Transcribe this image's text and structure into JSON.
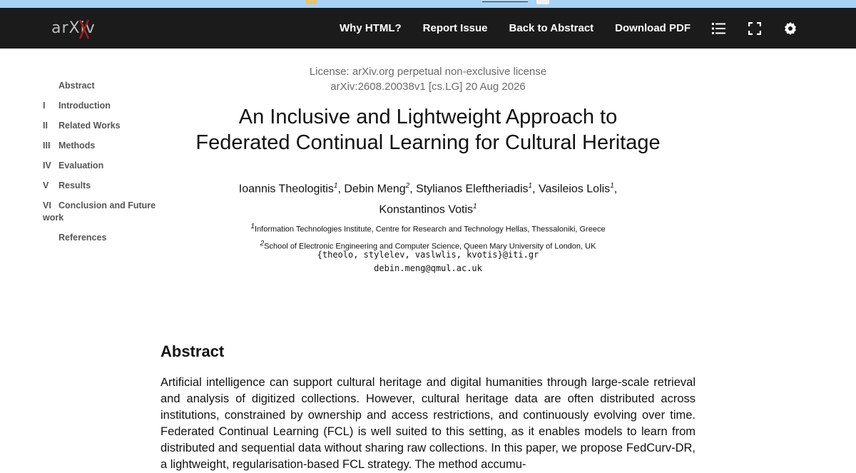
{
  "navbar": {
    "logo_text": "arXiv",
    "links": [
      "Why HTML?",
      "Report Issue",
      "Back to Abstract",
      "Download PDF"
    ],
    "icons": [
      "list-icon",
      "fullscreen-icon",
      "settings-icon"
    ]
  },
  "toc": [
    {
      "num": "",
      "label": "Abstract"
    },
    {
      "num": "I",
      "label": "Introduction"
    },
    {
      "num": "II",
      "label": "Related Works"
    },
    {
      "num": "III",
      "label": "Methods"
    },
    {
      "num": "IV",
      "label": "Evaluation"
    },
    {
      "num": "V",
      "label": "Results"
    },
    {
      "num": "VI",
      "label": "Conclusion and Future work"
    },
    {
      "num": "",
      "label": "References"
    }
  ],
  "paper": {
    "license": "License: arXiv.org perpetual non-exclusive license",
    "arxiv_id": "arXiv:2608.20038v1 [cs.LG] 20 Aug 2026",
    "title_line1": "An Inclusive and Lightweight Approach to",
    "title_line2": "Federated Continual Learning for Cultural Heritage",
    "authors": [
      {
        "name": "Ioannis Theologitis",
        "aff": "1"
      },
      {
        "name": "Debin Meng",
        "aff": "2"
      },
      {
        "name": "Stylianos Eleftheriadis",
        "aff": "1"
      },
      {
        "name": "Vasileios Lolis",
        "aff": "1"
      },
      {
        "name": "Konstantinos Votis",
        "aff": "1"
      }
    ],
    "affiliations": [
      {
        "num": "1",
        "text": "Information Technologies Institute, Centre for Research and Technology Hellas, Thessaloniki, Greece"
      },
      {
        "num": "2",
        "text": "School of Electronic Engineering and Computer Science, Queen Mary University of London, UK"
      }
    ],
    "email_line1": "{theolo, stylelev, vaslwlis, kvotis}@iti.gr",
    "email_line2": "debin.meng@qmul.ac.uk",
    "abstract_heading": "Abstract",
    "abstract_text": "Artificial intelligence can support cultural heritage and digital humanities through large-scale retrieval and analysis of digitized collections. However, cultural heritage data are often distributed across institutions, constrained by ownership and access restrictions, and continuously evolving over time. Federated Continual Learning (FCL) is well suited to this setting, as it enables models to learn from distributed and sequential data without sharing raw collections. In this paper, we propose FedCurv-DR, a lightweight, regularisation-based FCL strategy. The method accumu-"
  }
}
